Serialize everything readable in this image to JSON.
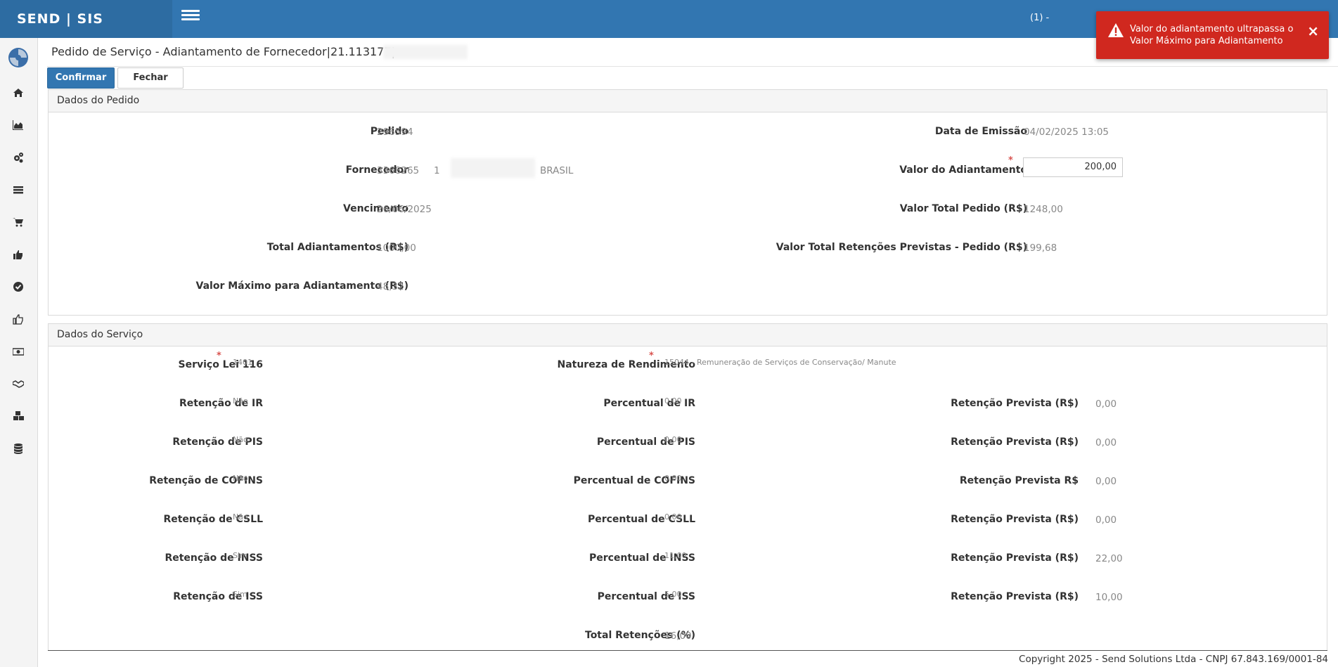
{
  "app": {
    "brand": "SEND | SIS",
    "user_count": "(1) -"
  },
  "sidebar": {
    "icons": [
      "home-icon",
      "area-chart-icon",
      "cogs-icon",
      "list-icon",
      "shopping-cart-icon",
      "thumbs-up-icon",
      "check-circle-icon",
      "thumbs-up-outline-icon",
      "money-icon",
      "handshake-icon",
      "cubes-icon",
      "database-icon"
    ]
  },
  "page": {
    "title": "Pedido de Serviço - Adiantamento de Fornecedor|21.113177|"
  },
  "toolbar": {
    "confirm_label": "Confirmar",
    "close_label": "Fechar"
  },
  "order": {
    "heading": "Dados do Pedido",
    "pedido_label": "Pedido",
    "pedido": "296594",
    "fornecedor_label": "Fornecedor",
    "fornecedor_code": "3368265",
    "fornecedor_seq": "1",
    "fornecedor_country": "BRASIL",
    "vencimento_label": "Vencimento",
    "vencimento": "26/06/2025",
    "total_adiant_label": "Total Adiantamentos (R$)",
    "total_adiant": "1000,00",
    "valor_max_label": "Valor Máximo para Adiantamento (R$)",
    "valor_max": "48,32",
    "data_emissao_label": "Data de Emissão",
    "data_emissao": "04/02/2025 13:05",
    "valor_adiant_label": "Valor do Adiantamento",
    "valor_adiant": "200,00",
    "valor_total_label": "Valor Total Pedido (R$)",
    "valor_total": "1248,00",
    "retencoes_label": "Valor Total Retenções Previstas - Pedido (R$)",
    "retencoes": "199,68"
  },
  "service": {
    "heading": "Dados do Serviço",
    "lei_label": "Serviço Lei 116",
    "lei": "1401",
    "natureza_label": "Natureza de Rendimento",
    "natureza": "15044 - Remuneração de Serviços de Conservação/ Manute",
    "rows": [
      {
        "ret_label": "Retenção de IR",
        "ret": "Não",
        "perc_label": "Percentual de IR",
        "perc": "0,00",
        "prev_label": "Retenção Prevista (R$)",
        "prev": "0,00"
      },
      {
        "ret_label": "Retenção de PIS",
        "ret": "Não",
        "perc_label": "Percentual de PIS",
        "perc": "0,00",
        "prev_label": "Retenção Prevista (R$)",
        "prev": "0,00"
      },
      {
        "ret_label": "Retenção de COFINS",
        "ret": "Não",
        "perc_label": "Percentual de COFINS",
        "perc": "0,00",
        "prev_label": "Retenção Prevista R$",
        "prev": "0,00"
      },
      {
        "ret_label": "Retenção de CSLL",
        "ret": "Não",
        "perc_label": "Percentual de CSLL",
        "perc": "0,00",
        "prev_label": "Retenção Prevista (R$)",
        "prev": "0,00"
      },
      {
        "ret_label": "Retenção de INSS",
        "ret": "Sim",
        "perc_label": "Percentual de INSS",
        "perc": "11,00",
        "prev_label": "Retenção Prevista (R$)",
        "prev": "22,00"
      },
      {
        "ret_label": "Retenção de ISS",
        "ret": "Sim",
        "perc_label": "Percentual de ISS",
        "perc": "5,00",
        "prev_label": "Retenção Prevista (R$)",
        "prev": "10,00"
      }
    ],
    "total_label": "Total Retenções (%)",
    "total": "16,00"
  },
  "footer": {
    "text": "Copyright 2025 - Send Solutions Ltda - CNPJ 67.843.169/0001-84"
  },
  "toast": {
    "message": "Valor do adiantamento ultrapassa o Valor Máximo para Adiantamento",
    "close": "×",
    "color": "#d0281f"
  }
}
